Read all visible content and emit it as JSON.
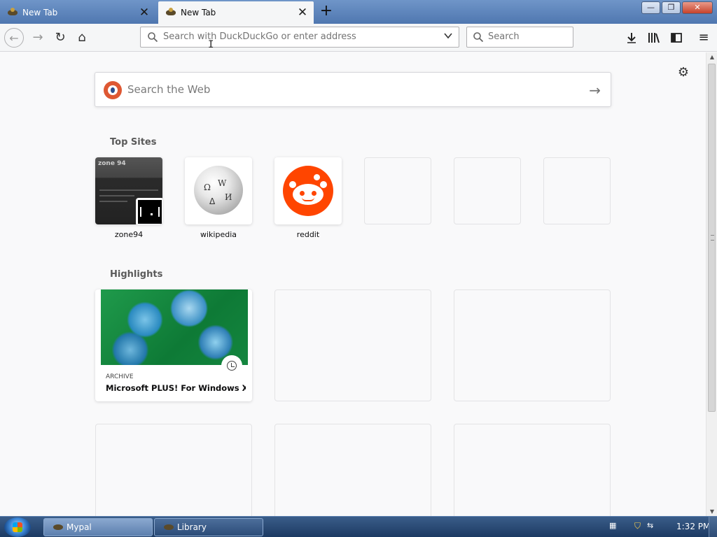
{
  "tabs": [
    {
      "title": "New Tab",
      "active": false
    },
    {
      "title": "New Tab",
      "active": true
    }
  ],
  "window_controls": {
    "minimize": "—",
    "restore": "❐",
    "close": "✕"
  },
  "toolbar": {
    "url_placeholder": "Search with DuckDuckGo or enter address",
    "search_placeholder": "Search",
    "dropdown_glyph": "⌄"
  },
  "newtab": {
    "websearch_placeholder": "Search the Web",
    "top_sites_title": "Top Sites",
    "highlights_title": "Highlights",
    "top_sites": [
      {
        "label": "zone94"
      },
      {
        "label": "wikipedia"
      },
      {
        "label": "reddit"
      },
      {
        "label": ""
      },
      {
        "label": ""
      },
      {
        "label": ""
      }
    ],
    "highlights": [
      {
        "context": "ARCHIVE",
        "title": "Microsoft PLUS! For Windows X..."
      }
    ],
    "zone_thumb_header": "zone 94"
  },
  "taskbar": {
    "tasks": [
      {
        "label": "Mypal"
      },
      {
        "label": "Library"
      }
    ],
    "clock": "1:32 PM"
  },
  "icons": {
    "back": "back-arrow-icon",
    "forward": "forward-arrow-icon",
    "reload": "reload-icon",
    "home": "home-icon",
    "downloads": "download-icon",
    "library": "library-icon",
    "sidebar": "sidebar-icon",
    "menu": "hamburger-menu-icon",
    "settings": "gear-icon"
  },
  "colors": {
    "reddit": "#ff4500",
    "duckduckgo": "#de5833",
    "tabbar": "#5f86bd"
  }
}
